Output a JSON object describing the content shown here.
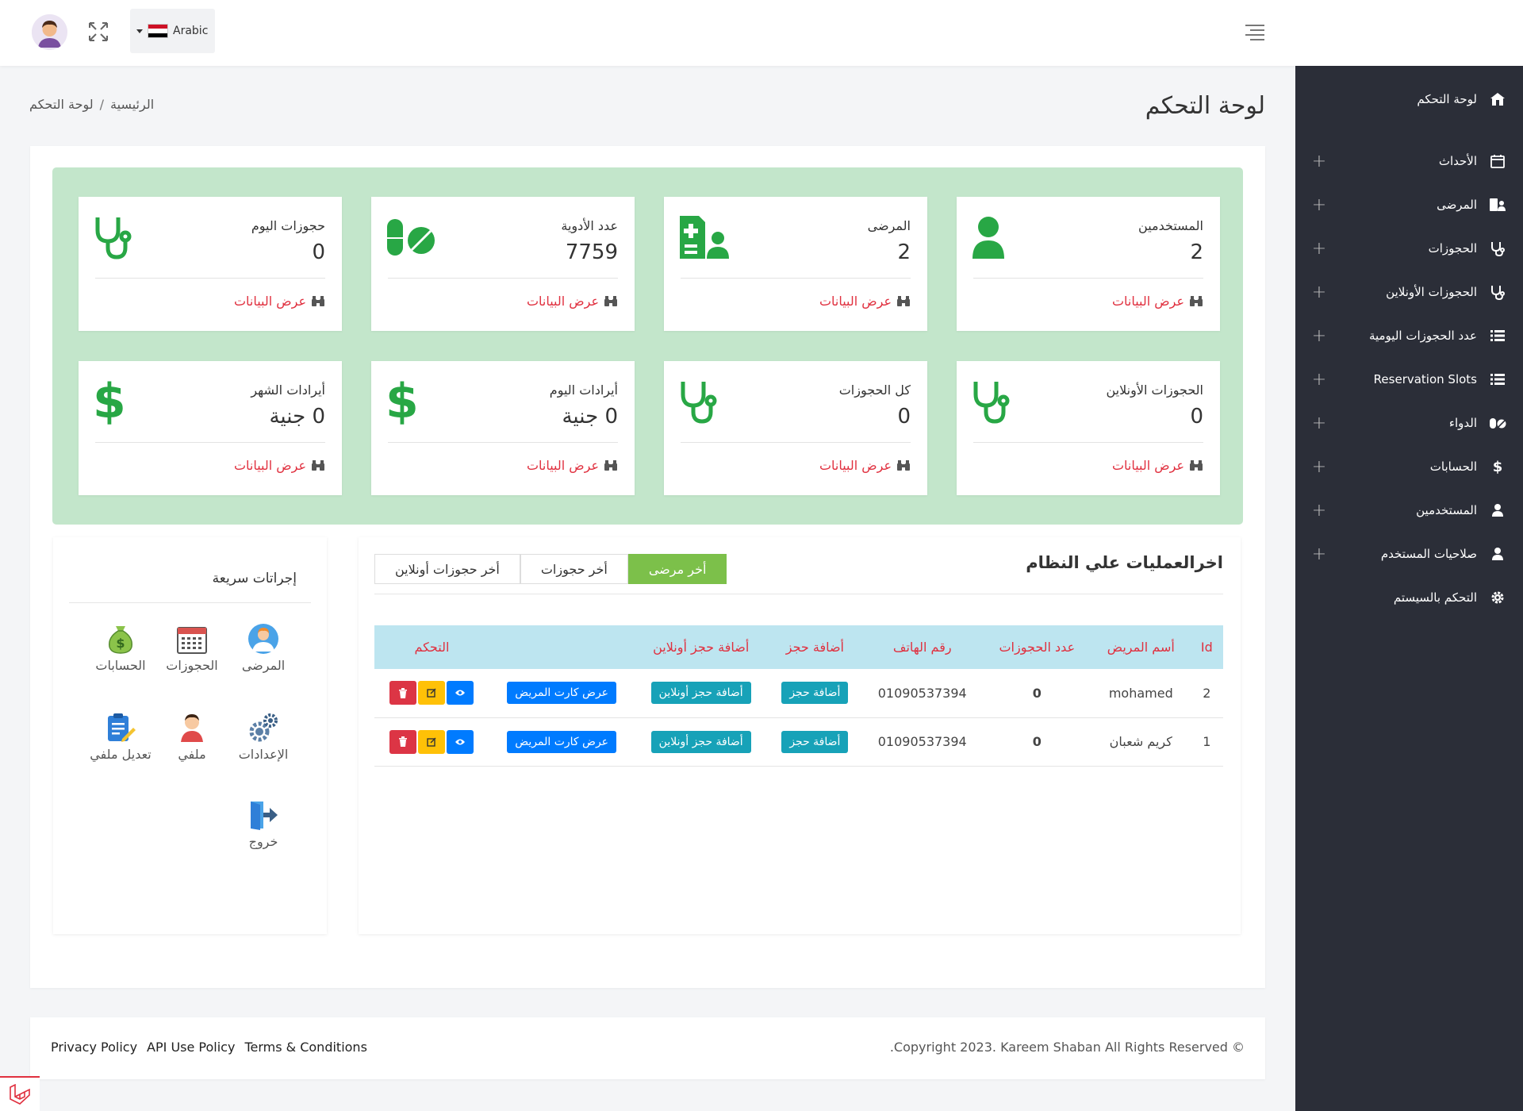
{
  "topbar": {
    "language": "Arabic",
    "colors": {
      "flag_red": "#ce1126",
      "flag_white": "#ffffff",
      "flag_black": "#000000"
    }
  },
  "sidebar": {
    "items": [
      {
        "label": "لوحة التحكم",
        "icon": "home-icon",
        "expandable": false
      },
      {
        "label": "الأحداث",
        "icon": "calendar-icon",
        "expandable": true
      },
      {
        "label": "المرضى",
        "icon": "patient-card-icon",
        "expandable": true
      },
      {
        "label": "الحجوزات",
        "icon": "stethoscope-icon",
        "expandable": true
      },
      {
        "label": "الحجوزات الأونلاين",
        "icon": "stethoscope-icon",
        "expandable": true
      },
      {
        "label": "عدد الحجوزات اليومية",
        "icon": "list-icon",
        "expandable": true
      },
      {
        "label": "Reservation Slots",
        "icon": "list-icon",
        "expandable": true
      },
      {
        "label": "الدواء",
        "icon": "pills-icon",
        "expandable": true
      },
      {
        "label": "الحسابات",
        "icon": "dollar-icon",
        "expandable": true
      },
      {
        "label": "المستخدمين",
        "icon": "user-icon",
        "expandable": true
      },
      {
        "label": "صلاحيات المستخدم",
        "icon": "user-icon",
        "expandable": true
      },
      {
        "label": "التحكم بالسيستم",
        "icon": "gear-icon",
        "expandable": false
      }
    ]
  },
  "page": {
    "title": "لوحة التحكم",
    "breadcrumb": {
      "home": "الرئيسية",
      "sep": "/",
      "current": "لوحة التحكم"
    }
  },
  "stats": [
    {
      "title": "المستخدمين",
      "value": "2",
      "icon": "user-icon",
      "link": "عرض البيانات"
    },
    {
      "title": "المرضى",
      "value": "2",
      "icon": "patient-card-icon",
      "link": "عرض البيانات"
    },
    {
      "title": "عدد الأدوية",
      "value": "7759",
      "icon": "pills-icon",
      "link": "عرض البيانات"
    },
    {
      "title": "حجوزات اليوم",
      "value": "0",
      "icon": "stethoscope-icon",
      "link": "عرض البيانات"
    },
    {
      "title": "الحجوزات الأونلاين",
      "value": "0",
      "icon": "stethoscope-icon",
      "link": "عرض البيانات"
    },
    {
      "title": "كل الحجوزات",
      "value": "0",
      "icon": "stethoscope-icon",
      "link": "عرض البيانات"
    },
    {
      "title": "أيرادات اليوم",
      "value": "0 جنية",
      "icon": "dollar-icon",
      "link": "عرض البيانات"
    },
    {
      "title": "أيرادات الشهر",
      "value": "0 جنية",
      "icon": "dollar-icon",
      "link": "عرض البيانات"
    }
  ],
  "recent": {
    "title": "اخرالعمليات علي النظام",
    "tabs": [
      "أخر مرضى",
      "أخر حجوزات",
      "أخر حجوزات أونلاين"
    ],
    "active_tab": "أخر مرضى",
    "columns": [
      "Id",
      "أسم المريض",
      "عدد الحجوزات",
      "رقم الهاتف",
      "أضافة حجز",
      "أضافة حجز أونلاين",
      "",
      "التحكم"
    ],
    "rows": [
      {
        "id": "2",
        "name": "mohamed",
        "count": "0",
        "phone": "01090537394",
        "add": "أضافة حجز",
        "add_online": "أضافة حجز أونلاين",
        "card": "عرض كارت المريض"
      },
      {
        "id": "1",
        "name": "كريم شعبان",
        "count": "0",
        "phone": "01090537394",
        "add": "أضافة حجز",
        "add_online": "أضافة حجز أونلاين",
        "card": "عرض كارت المريض"
      }
    ]
  },
  "quick": {
    "title": "إجراتات سريعة",
    "items": [
      {
        "label": "المرضى",
        "icon": "doctor-icon"
      },
      {
        "label": "الحجوزات",
        "icon": "calendar-grid-icon"
      },
      {
        "label": "الحسابات",
        "icon": "money-bag-icon"
      },
      {
        "label": "الإعدادات",
        "icon": "gears-icon"
      },
      {
        "label": "ملفي",
        "icon": "profile-icon"
      },
      {
        "label": "تعديل ملفي",
        "icon": "clipboard-edit-icon"
      },
      {
        "label": "خروج",
        "icon": "logout-icon"
      }
    ]
  },
  "footer": {
    "links": [
      "Privacy Policy",
      "API Use Policy",
      "Terms & Conditions"
    ],
    "copyright": ".Copyright 2023. Kareem Shaban All Rights Reserved ©"
  },
  "colors": {
    "sidebar_bg": "#2b2e38",
    "panel_green": "#c3e6cb",
    "icon_green": "#28a745",
    "link_red": "#e0303f",
    "tab_active": "#7cc04a",
    "table_head": "#bde5f0"
  }
}
